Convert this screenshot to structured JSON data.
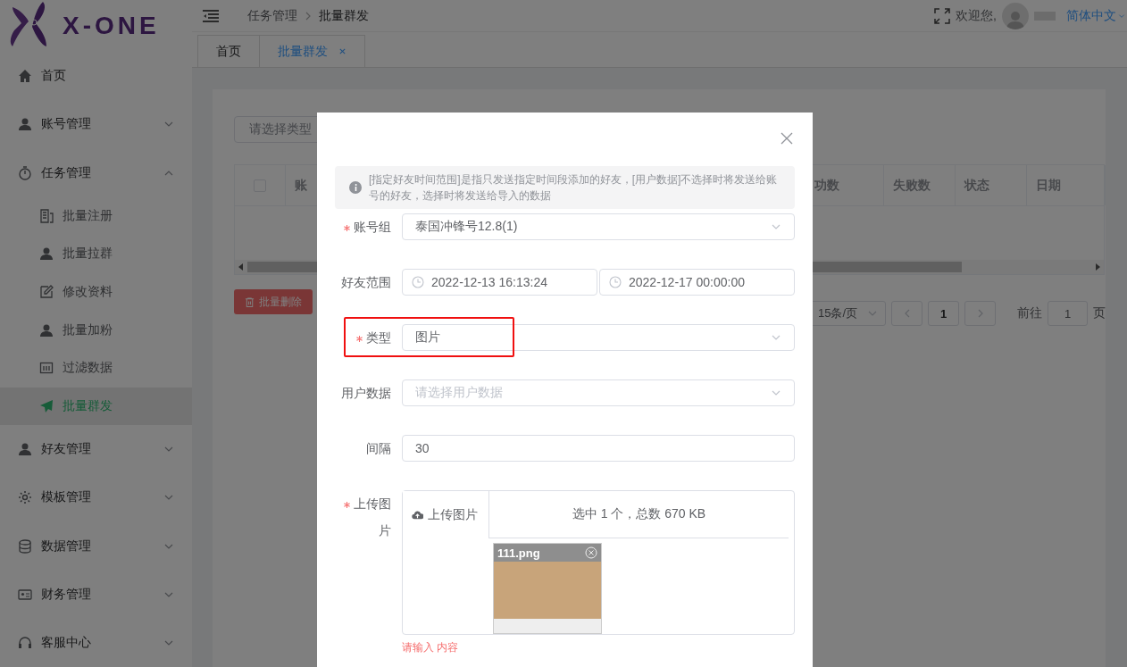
{
  "logo": {
    "text": "X-ONE"
  },
  "header": {
    "breadcrumb": [
      "任务管理",
      "批量群发"
    ],
    "welcome": "欢迎您,",
    "language": "简体中文"
  },
  "tabs": [
    {
      "label": "首页",
      "selected": false,
      "closable": false
    },
    {
      "label": "批量群发",
      "selected": true,
      "closable": true
    }
  ],
  "sidebar": {
    "items": [
      {
        "label": "首页",
        "selected": false
      },
      {
        "label": "账号管理",
        "selected": false,
        "expanded": false
      },
      {
        "label": "任务管理",
        "selected": false,
        "expanded": true,
        "children": [
          {
            "label": "批量注册",
            "selected": false
          },
          {
            "label": "批量拉群",
            "selected": false
          },
          {
            "label": "修改资料",
            "selected": false
          },
          {
            "label": "批量加粉",
            "selected": false
          },
          {
            "label": "过滤数据",
            "selected": false
          },
          {
            "label": "批量群发",
            "selected": true
          }
        ]
      },
      {
        "label": "好友管理",
        "selected": false,
        "expanded": false
      },
      {
        "label": "模板管理",
        "selected": false,
        "expanded": false
      },
      {
        "label": "数据管理",
        "selected": false,
        "expanded": false
      },
      {
        "label": "财务管理",
        "selected": false,
        "expanded": false
      },
      {
        "label": "客服中心",
        "selected": false,
        "expanded": false
      }
    ]
  },
  "content": {
    "filter": {
      "placeholder": "请选择类型"
    },
    "table": {
      "select_all_checked": false,
      "columns": [
        "账",
        "功数",
        "失败数",
        "状态",
        "日期"
      ]
    },
    "delete_button": "批量删除",
    "pagination": {
      "page_size": "15条/页",
      "current_page": "1",
      "goto_label": "前往",
      "goto_value": "1",
      "page_suffix": "页"
    }
  },
  "dialog": {
    "notice": "[指定好友时间范围]是指只发送指定时间段添加的好友，[用户数据]不选择时将发送给账号的好友，选择时将发送给导入的数据",
    "fields": [
      {
        "kind": "select",
        "label": "账号组",
        "required": true,
        "value": "泰国冲锋号12.8(1)",
        "highlighted": false
      },
      {
        "kind": "daterange",
        "label": "好友范围",
        "required": false,
        "start": "2022-12-13 16:13:24",
        "end": "2022-12-17 00:00:00",
        "highlighted": false
      },
      {
        "kind": "select",
        "label": "类型",
        "required": true,
        "value": "图片",
        "highlighted": true
      },
      {
        "kind": "select",
        "label": "用户数据",
        "required": false,
        "placeholder": "请选择用户数据",
        "highlighted": false
      },
      {
        "kind": "input",
        "label": "间隔",
        "required": false,
        "value": "30",
        "highlighted": false
      },
      {
        "kind": "upload",
        "label": "上传图片",
        "required": true,
        "button": "上传图片",
        "summary": "选中 1 个，总数 670 KB",
        "file_name": "111.png",
        "error": "请输入 内容",
        "highlighted": false
      }
    ]
  }
}
